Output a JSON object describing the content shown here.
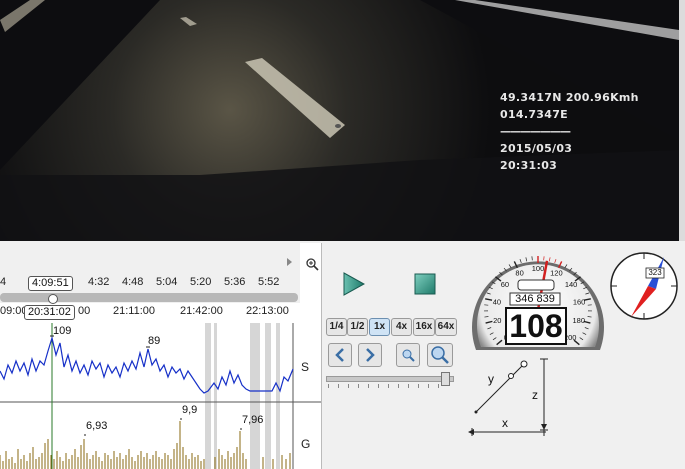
{
  "video": {
    "overlay": {
      "lat_speed": "49.3417N 200.96Kmh",
      "lon": "014.7347E",
      "separator": "———————",
      "date": "2015/05/03",
      "time": "20:31:03"
    }
  },
  "timeline": {
    "top_ticks": [
      "4",
      "4:09:51",
      "4:32",
      "4:48",
      "5:04",
      "5:20",
      "5:36",
      "5:52"
    ],
    "current_time": "20:31:02",
    "mid_ticks": [
      "09:00",
      "00",
      "21:11:00",
      "21:42:00",
      "22:13:00"
    ],
    "zoom_icon": "zoom-in-icon",
    "speed_panel": {
      "label": "S",
      "peak_label": "109",
      "secondary_label": "89"
    },
    "g_panel": {
      "label": "G",
      "annotations": [
        "6,93",
        "9,9",
        "7,96"
      ]
    }
  },
  "controls": {
    "play_icon": "play-icon",
    "stop_icon": "stop-icon",
    "speeds": [
      "1/4",
      "1/2",
      "1x",
      "4x",
      "16x",
      "64x"
    ],
    "selected_speed": "1x",
    "prev_icon": "chevron-left-icon",
    "next_icon": "chevron-right-icon",
    "zoom_out_icon": "zoom-out-icon",
    "zoom_in_icon": "zoom-in-icon",
    "slider_level": 0.93
  },
  "gauge": {
    "ticks": [
      "0",
      "20",
      "40",
      "60",
      "80",
      "100",
      "120",
      "140",
      "160",
      "180",
      "200"
    ],
    "odometer": "346 839",
    "speed": "108",
    "needle_value": 108,
    "max": 200,
    "accent_color": "#d22020"
  },
  "compass": {
    "heading_label": "323",
    "north_color": "#2a4fd6",
    "south_color": "#e02020"
  },
  "axes": {
    "x_label": "x",
    "y_label": "y",
    "z_label": "z"
  }
}
